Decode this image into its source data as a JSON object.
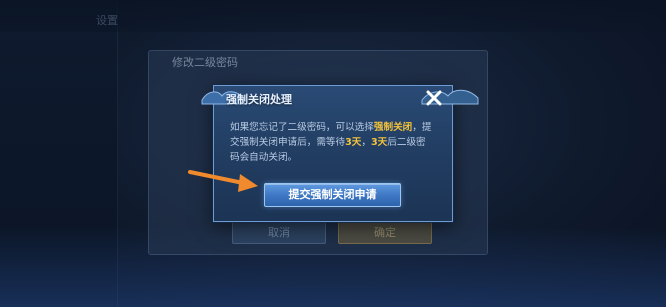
{
  "background": {
    "top_text": "设置",
    "sidebar_items": [
      "",
      "",
      "",
      "",
      ""
    ]
  },
  "under_panel": {
    "title": "修改二级密码",
    "cancel_label": "取消",
    "confirm_label": "确定"
  },
  "dialog": {
    "title": "强制关闭处理",
    "close_icon": "close-icon",
    "body": {
      "part1": "如果您忘记了二级密码，可以选择",
      "highlight1": "强制关闭",
      "part2": "，提交强制关闭申请后，需等待",
      "highlight2": "3天",
      "part3": "，",
      "highlight3": "3天",
      "part4": "后二级密码会自动关闭。"
    },
    "submit_label": "提交强制关闭申请"
  },
  "colors": {
    "highlight": "#f3c33c",
    "arrow": "#f08a2c",
    "dialog_border": "#6f9bd0"
  }
}
